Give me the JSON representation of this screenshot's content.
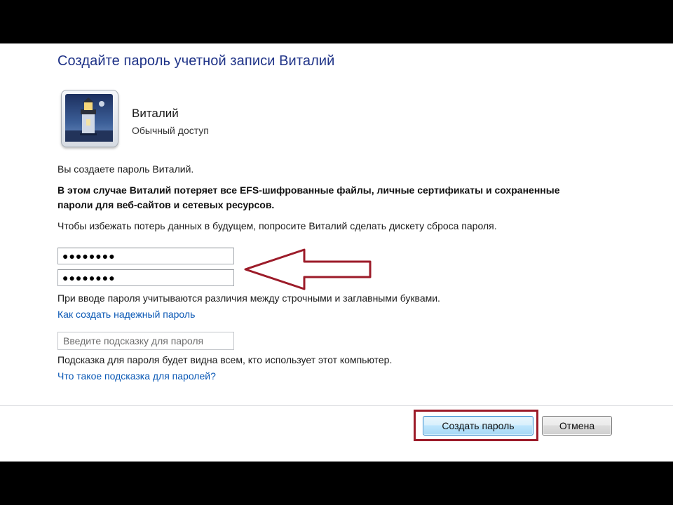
{
  "dialog": {
    "title": "Создайте пароль учетной записи Виталий"
  },
  "user": {
    "name": "Виталий",
    "account_type": "Обычный доступ",
    "avatar_icon": "lighthouse-avatar-icon"
  },
  "messages": {
    "info": "Вы создаете пароль Виталий.",
    "warning": "В этом случае Виталий потеряет все EFS-шифрованные файлы, личные сертификаты и сохраненные пароли для веб-сайтов и сетевых ресурсов.",
    "advice": "Чтобы избежать потерь данных в будущем, попросите Виталий сделать дискету сброса пароля.",
    "case_note": "При вводе пароля учитываются различия между строчными и заглавными буквами.",
    "hint_note": "Подсказка для пароля будет видна всем, кто использует этот компьютер."
  },
  "fields": {
    "new_password_value": "●●●●●●●●",
    "confirm_password_value": "●●●●●●●●",
    "hint_placeholder": "Введите подсказку для пароля"
  },
  "links": {
    "strong_password": "Как создать надежный пароль",
    "what_is_hint": "Что такое подсказка для паролей?"
  },
  "buttons": {
    "create_password": "Создать пароль",
    "cancel": "Отмена"
  },
  "annotations": {
    "arrow_color": "#9c1b29",
    "highlight_color": "#9c1b29"
  }
}
